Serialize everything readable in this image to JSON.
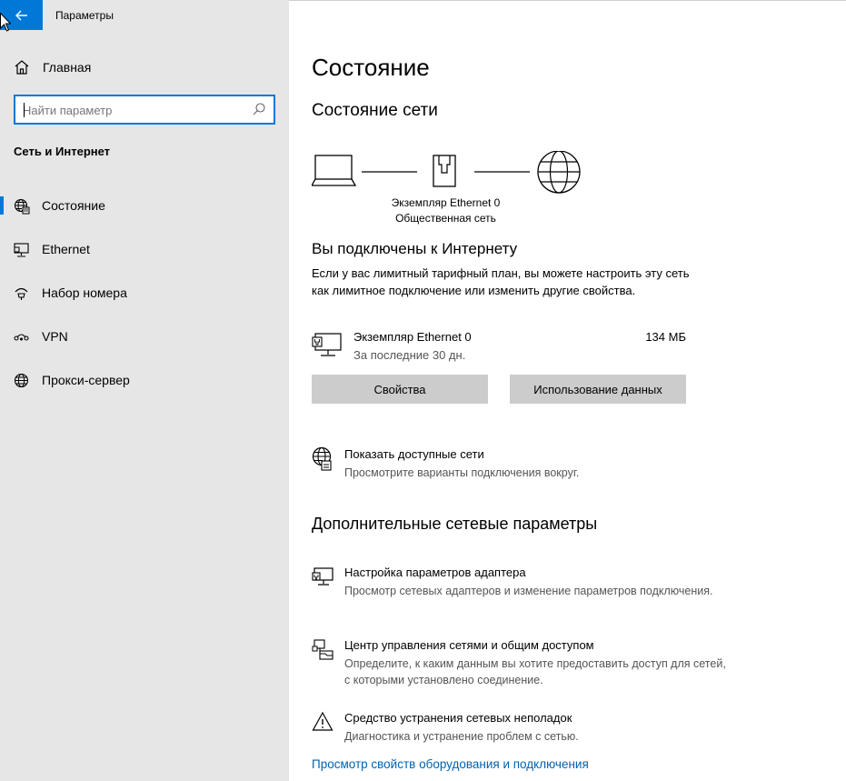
{
  "window": {
    "title": "Параметры"
  },
  "sidebar": {
    "home_label": "Главная",
    "search_placeholder": "Найти параметр",
    "section_title": "Сеть и Интернет",
    "items": [
      {
        "label": "Состояние",
        "icon": "globe-status-icon",
        "selected": true
      },
      {
        "label": "Ethernet",
        "icon": "ethernet-icon",
        "selected": false
      },
      {
        "label": "Набор номера",
        "icon": "dialup-icon",
        "selected": false
      },
      {
        "label": "VPN",
        "icon": "vpn-icon",
        "selected": false
      },
      {
        "label": "Прокси-сервер",
        "icon": "globe-icon",
        "selected": false
      }
    ]
  },
  "main": {
    "page_title": "Состояние",
    "network_status_title": "Состояние сети",
    "diagram": {
      "adapter_name": "Экземпляр Ethernet 0",
      "network_type": "Общественная сеть"
    },
    "connected_title": "Вы подключены к Интернету",
    "connected_desc": "Если у вас лимитный тарифный план, вы можете настроить эту сеть как лимитное подключение или изменить другие свойства.",
    "adapter": {
      "name": "Экземпляр Ethernet 0",
      "period": "За последние 30 дн.",
      "usage": "134 МБ"
    },
    "buttons": {
      "properties": "Свойства",
      "data_usage": "Использование данных"
    },
    "show_networks": {
      "title": "Показать доступные сети",
      "desc": "Просмотрите варианты подключения вокруг."
    },
    "advanced_title": "Дополнительные сетевые параметры",
    "advanced": [
      {
        "title": "Настройка параметров адаптера",
        "desc": "Просмотр сетевых адаптеров и изменение параметров подключения."
      },
      {
        "title": "Центр управления сетями и общим доступом",
        "desc": "Определите, к каким данным вы хотите предоставить доступ для сетей, с которыми установлено соединение."
      },
      {
        "title": "Средство устранения сетевых неполадок",
        "desc": "Диагностика и устранение проблем с сетью."
      }
    ],
    "hardware_link": "Просмотр свойств оборудования и подключения"
  },
  "colors": {
    "accent": "#0078d7",
    "sidebar_bg": "#e6e6e6",
    "button_bg": "#cccccc",
    "link": "#0063b1"
  }
}
